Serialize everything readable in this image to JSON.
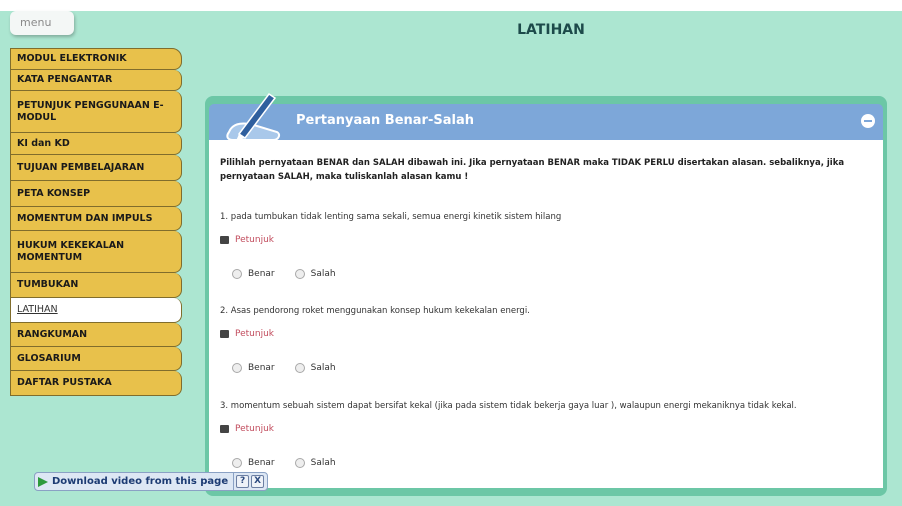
{
  "menu_tab": {
    "label": "menu"
  },
  "page_title": "LATIHAN",
  "sidebar": {
    "items": [
      {
        "label": "MODUL ELEKTRONIK",
        "active": false
      },
      {
        "label": "KATA PENGANTAR",
        "active": false
      },
      {
        "label": "PETUNJUK PENGGUNAAN E-MODUL",
        "active": false
      },
      {
        "label": "KI dan KD",
        "active": false
      },
      {
        "label": "TUJUAN PEMBELAJARAN",
        "active": false
      },
      {
        "label": "PETA KONSEP",
        "active": false
      },
      {
        "label": "MOMENTUM DAN IMPULS",
        "active": false
      },
      {
        "label": "HUKUM KEKEKALAN MOMENTUM",
        "active": false
      },
      {
        "label": "TUMBUKAN",
        "active": false
      },
      {
        "label": "LATIHAN",
        "active": true
      },
      {
        "label": "RANGKUMAN",
        "active": false
      },
      {
        "label": "GLOSARIUM",
        "active": false
      },
      {
        "label": "DAFTAR PUSTAKA",
        "active": false
      }
    ]
  },
  "card": {
    "title": "Pertanyaan Benar-Salah",
    "instruction": "Pilihlah pernyataan BENAR dan SALAH dibawah ini. Jika pernyataan BENAR maka TIDAK PERLU disertakan alasan. sebaliknya, jika pernyataan SALAH, maka tuliskanlah alasan kamu !",
    "questions": [
      {
        "text": "1. pada tumbukan tidak lenting sama sekali, semua energi kinetik sistem hilang",
        "hint": "Petunjuk",
        "opt_true": "Benar",
        "opt_false": "Salah"
      },
      {
        "text": "2. Asas pendorong roket menggunakan konsep hukum kekekalan energi.",
        "hint": "Petunjuk",
        "opt_true": "Benar",
        "opt_false": "Salah"
      },
      {
        "text": "3. momentum sebuah sistem dapat bersifat kekal (jika pada sistem tidak bekerja gaya luar ), walaupun energi mekaniknya tidak kekal.",
        "hint": "Petunjuk",
        "opt_true": "Benar",
        "opt_false": "Salah"
      }
    ]
  },
  "download_bar": {
    "label": "Download video from this page",
    "help": "?",
    "close": "X"
  },
  "colors": {
    "background": "#ace6d1",
    "sidebar": "#e8c14b",
    "header": "#7da7d9",
    "hint": "#c24d5e"
  }
}
